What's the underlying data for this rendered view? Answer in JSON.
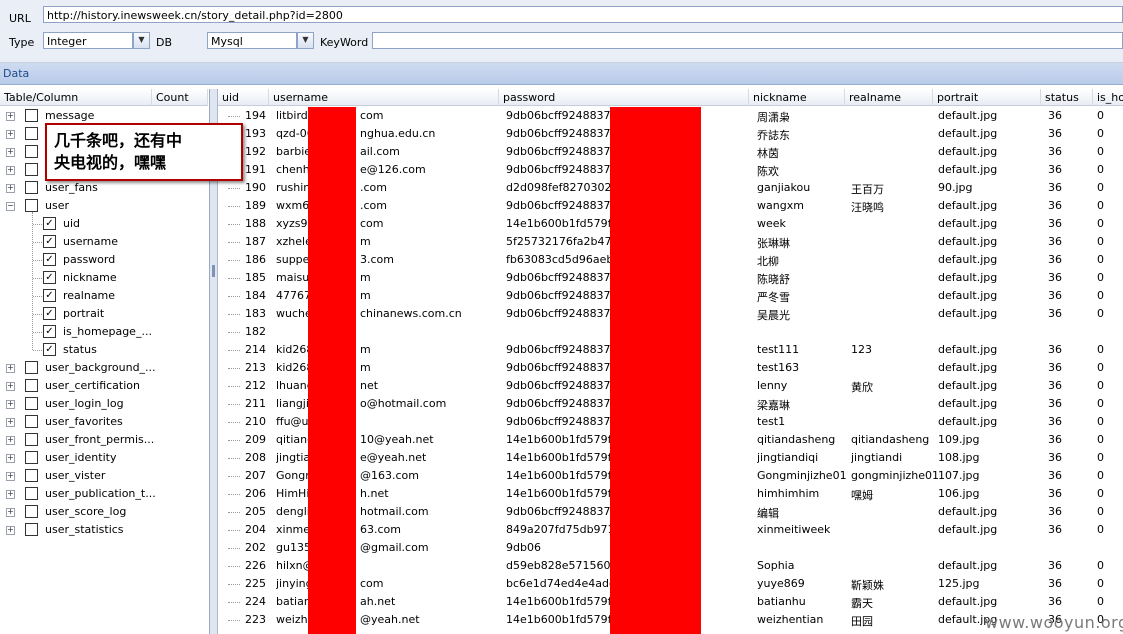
{
  "toolbar": {
    "url_label": "URL",
    "url_value": "http://history.inewsweek.cn/story_detail.php?id=2800",
    "type_label": "Type",
    "type_value": "Integer",
    "db_label": "DB",
    "db_value": "Mysql",
    "keyword_label": "KeyWord",
    "keyword_value": ""
  },
  "data_label": "Data",
  "tree": {
    "headers": [
      "Table/Column",
      "Count"
    ],
    "items": [
      {
        "label": "message",
        "level": 0,
        "checked": false
      },
      {
        "label": "",
        "level": 0,
        "checked": false
      },
      {
        "label": "",
        "level": 0,
        "checked": false
      },
      {
        "label": "",
        "level": 0,
        "checked": false
      },
      {
        "label": "user_fans",
        "level": 0,
        "checked": false
      },
      {
        "label": "user",
        "level": 0,
        "checked": false,
        "expanded": true
      },
      {
        "label": "uid",
        "level": 1,
        "checked": true
      },
      {
        "label": "username",
        "level": 1,
        "checked": true
      },
      {
        "label": "password",
        "level": 1,
        "checked": true
      },
      {
        "label": "nickname",
        "level": 1,
        "checked": true
      },
      {
        "label": "realname",
        "level": 1,
        "checked": true
      },
      {
        "label": "portrait",
        "level": 1,
        "checked": true
      },
      {
        "label": "is_homepage_...",
        "level": 1,
        "checked": true
      },
      {
        "label": "status",
        "level": 1,
        "checked": true
      },
      {
        "label": "user_background_...",
        "level": 0,
        "checked": false
      },
      {
        "label": "user_certification",
        "level": 0,
        "checked": false
      },
      {
        "label": "user_login_log",
        "level": 0,
        "checked": false
      },
      {
        "label": "user_favorites",
        "level": 0,
        "checked": false
      },
      {
        "label": "user_front_permis...",
        "level": 0,
        "checked": false
      },
      {
        "label": "user_identity",
        "level": 0,
        "checked": false
      },
      {
        "label": "user_vister",
        "level": 0,
        "checked": false
      },
      {
        "label": "user_publication_t...",
        "level": 0,
        "checked": false
      },
      {
        "label": "user_score_log",
        "level": 0,
        "checked": false
      },
      {
        "label": "user_statistics",
        "level": 0,
        "checked": false
      }
    ]
  },
  "grid": {
    "columns": [
      "uid",
      "username",
      "password",
      "nickname",
      "realname",
      "portrait",
      "status",
      "is_hon"
    ],
    "rows": [
      [
        "194",
        "litbirdz",
        "com",
        "9db06bcff9248837f8",
        "周潇枭",
        "",
        "default.jpg",
        "36",
        "0"
      ],
      [
        "193",
        "qzd-06",
        "nghua.edu.cn",
        "9db06bcff9248837f8",
        "乔誌东",
        "",
        "default.jpg",
        "36",
        "0"
      ],
      [
        "192",
        "barbie",
        "ail.com",
        "9db06bcff9248837f8",
        "林茵",
        "",
        "default.jpg",
        "36",
        "0"
      ],
      [
        "191",
        "chenhu",
        "e@126.com",
        "9db06bcff9248837f8",
        "陈欢",
        "",
        "default.jpg",
        "36",
        "0"
      ],
      [
        "190",
        "rushing",
        ".com",
        "d2d098fef8270302c0",
        "ganjiakou",
        "王百万",
        "90.jpg",
        "36",
        "0"
      ],
      [
        "189",
        "wxm69",
        ".com",
        "9db06bcff9248837f8",
        "wangxm",
        "汪晓鸣",
        "default.jpg",
        "36",
        "0"
      ],
      [
        "188",
        "xyzs99",
        "com",
        "14e1b600b1fd579f47",
        "week",
        "",
        "default.jpg",
        "36",
        "0"
      ],
      [
        "187",
        "xzhele",
        "m",
        "5f25732176fa2b4756",
        "张琳琳",
        "",
        "default.jpg",
        "36",
        "0"
      ],
      [
        "186",
        "supper",
        "3.com",
        "fb63083cd5d96aeb11",
        "北柳",
        "",
        "default.jpg",
        "36",
        "0"
      ],
      [
        "185",
        "maisui",
        "m",
        "9db06bcff9248837f8",
        "陈晓舒",
        "",
        "default.jpg",
        "36",
        "0"
      ],
      [
        "184",
        "47767",
        "m",
        "9db06bcff9248837f8",
        "严冬雪",
        "",
        "default.jpg",
        "36",
        "0"
      ],
      [
        "183",
        "wuche",
        "chinanews.com.cn",
        "9db06bcff9248837f8",
        "吴晨光",
        "",
        "default.jpg",
        "36",
        "0"
      ],
      [
        "182",
        "",
        "",
        "",
        "",
        "",
        "",
        "",
        ""
      ],
      [
        "214",
        "kid268",
        "m",
        "9db06bcff9248837f8",
        "test111",
        "123",
        "default.jpg",
        "36",
        "0"
      ],
      [
        "213",
        "kid268",
        "m",
        "9db06bcff9248837f8",
        "test163",
        "",
        "default.jpg",
        "36",
        "0"
      ],
      [
        "212",
        "lhuang",
        "net",
        "9db06bcff9248837f8",
        "lenny",
        "黄欣",
        "default.jpg",
        "36",
        "0"
      ],
      [
        "211",
        "liangjia",
        "o@hotmail.com",
        "9db06bcff9248837f8",
        "梁嘉琳",
        "",
        "default.jpg",
        "36",
        "0"
      ],
      [
        "210",
        "ffu@u",
        "",
        "9db06bcff9248837f8",
        "test1",
        "",
        "default.jpg",
        "36",
        "0"
      ],
      [
        "209",
        "qitiand",
        "10@yeah.net",
        "14e1b600b1fd579f47",
        "qitiandasheng",
        "qitiandasheng",
        "109.jpg",
        "36",
        "0"
      ],
      [
        "208",
        "jingtian",
        "e@yeah.net",
        "14e1b600b1fd579f47",
        "jingtiandiqi",
        "jingtiandi",
        "108.jpg",
        "36",
        "0"
      ],
      [
        "207",
        "Gongm",
        "@163.com",
        "14e1b600b1fd579f47",
        "Gongminjizhe01",
        "gongminjizhe01",
        "107.jpg",
        "36",
        "0"
      ],
      [
        "206",
        "HimHim",
        "h.net",
        "14e1b600b1fd579f47",
        "himhimhim",
        "嘿姆",
        "106.jpg",
        "36",
        "0"
      ],
      [
        "205",
        "denglil",
        "hotmail.com",
        "9db06bcff9248837f8",
        "编辑",
        "",
        "default.jpg",
        "36",
        "0"
      ],
      [
        "204",
        "xinmei",
        "63.com",
        "849a207fd75db971e9",
        "xinmeitiweek",
        "",
        "default.jpg",
        "36",
        "0"
      ],
      [
        "202",
        "gu135",
        "@gmail.com",
        "9db06",
        "",
        "",
        "",
        "",
        ""
      ],
      [
        "226",
        "hilxn@",
        "",
        "d59eb828e57156014",
        "Sophia",
        "",
        "default.jpg",
        "36",
        "0"
      ],
      [
        "225",
        "jinying",
        "com",
        "bc6e1d74ed4e4add7",
        "yuye869",
        "靳颖姝",
        "125.jpg",
        "36",
        "0"
      ],
      [
        "224",
        "batianl",
        "ah.net",
        "14e1b600b1fd579f47",
        "batianhu",
        "霸天",
        "default.jpg",
        "36",
        "0"
      ],
      [
        "223",
        "weizhe",
        "@yeah.net",
        "14e1b600b1fd579f47",
        "weizhentian",
        "田园",
        "default.jpg",
        "36",
        "0"
      ]
    ]
  },
  "callout": {
    "line1": "几千条吧，还有中",
    "line2": "央电视的，嘿嘿"
  },
  "watermark": "www.wooyun.org",
  "colors": {
    "redaction": "#ff0000",
    "callout_border": "#b00000",
    "accent": "#1f4a8c"
  }
}
